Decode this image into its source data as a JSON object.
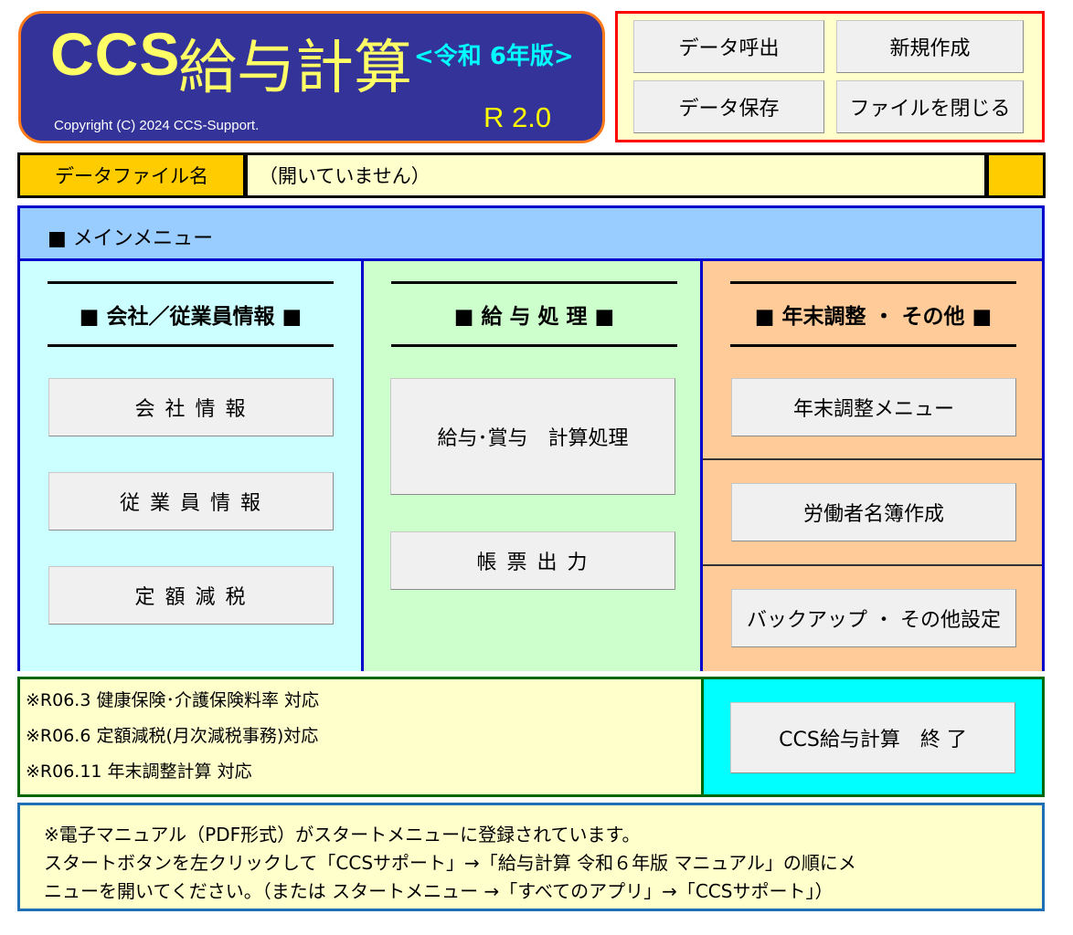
{
  "header": {
    "logo": "CCS",
    "app_name": "給与計算",
    "edition": "<令和 6年版>",
    "copyright": "Copyright (C) 2024 CCS-Support.",
    "version": "R 2.0"
  },
  "file_commands": {
    "load": "データ呼出",
    "new": "新規作成",
    "save": "データ保存",
    "close": "ファイルを閉じる"
  },
  "data_file": {
    "label": "データファイル名",
    "value": "（開いていません）"
  },
  "main_menu": {
    "title": "■ メインメニュー",
    "company": {
      "heading": "■ 会社／従業員情報 ■",
      "buttons": [
        "会 社 情 報",
        "従 業 員 情 報",
        "定 額 減 税"
      ]
    },
    "payroll": {
      "heading": "■ 給 与 処 理 ■",
      "buttons": [
        "給与･賞与　計算処理",
        "帳 票 出 力"
      ]
    },
    "yearend": {
      "heading": "■ 年末調整 ・ その他 ■",
      "buttons": [
        "年末調整メニュー",
        "労働者名簿作成",
        "バックアップ ・ その他設定"
      ]
    }
  },
  "notes": [
    "※R06.3 健康保険･介護保険料率 対応",
    "※R06.6 定額減税(月次減税事務)対応",
    "※R06.11 年末調整計算 対応"
  ],
  "exit_button": "CCS給与計算　終 了",
  "manual_info": [
    "※電子マニュアル（PDF形式）がスタートメニューに登録されています。",
    "スタートボタンを左クリックして「CCSサポート」→「給与計算 令和６年版 マニュアル」の順にメ",
    "ニューを開いてください。（または スタートメニュー →「すべてのアプリ」→「CCSサポート」）"
  ],
  "colors": {
    "banner": "#333399",
    "banner_border": "#ff7a1a",
    "title_text": "#ffff66",
    "edition_text": "#00ffff",
    "file_panel_border": "#ff0000",
    "menu_border": "#0000cc",
    "menu_header": "#99ccff",
    "company_bg": "#ccffff",
    "payroll_bg": "#ccffcc",
    "yearend_bg": "#ffcc99",
    "notes_bg": "#ffffcc",
    "exit_bg": "#00ffff"
  }
}
